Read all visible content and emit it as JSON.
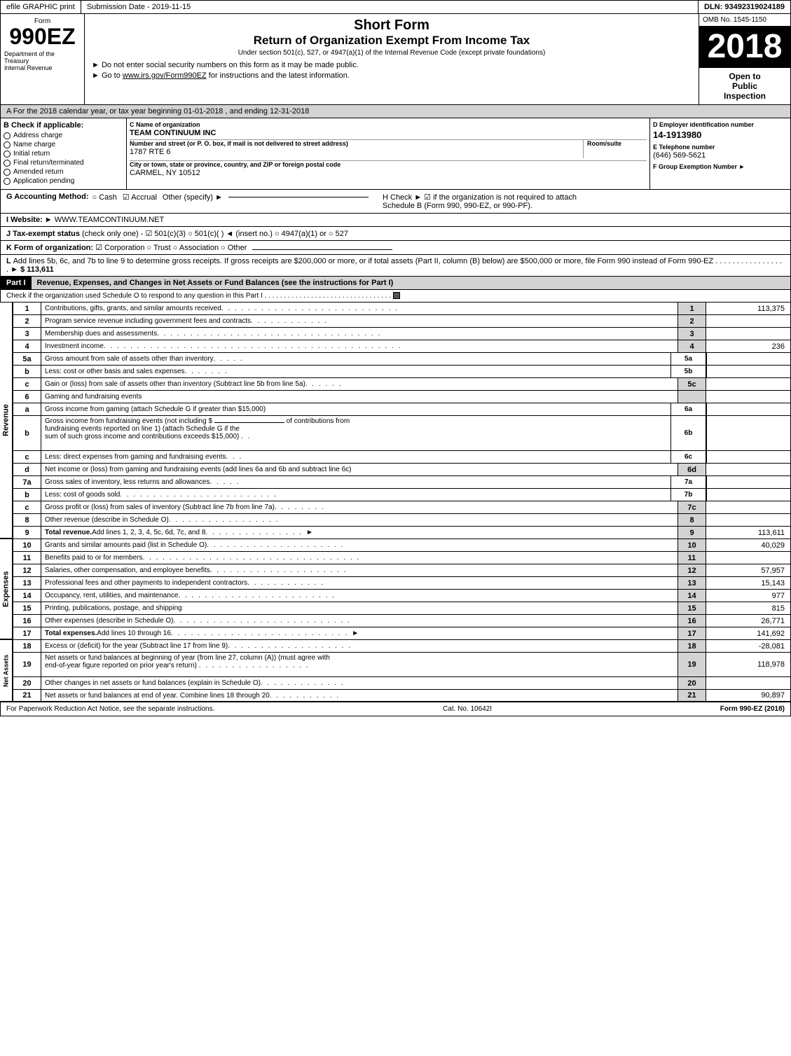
{
  "topbar": {
    "efile": "efile GRAPHIC print",
    "submission_label": "Submission Date - 2019-11-15",
    "dln_label": "DLN: 93492319024189"
  },
  "header": {
    "form_label": "Form",
    "form_number": "990EZ",
    "dept_line1": "Department of the",
    "dept_line2": "Treasury",
    "dept_line3": "Internal Revenue",
    "short_form": "Short Form",
    "return_title": "Return of Organization Exempt From Income Tax",
    "under_section": "Under section 501(c), 527, or 4947(a)(1) of the Internal Revenue Code (except private foundations)",
    "do_not_enter": "► Do not enter social security numbers on this form as it may be made public.",
    "go_to_irs": "► Go to www.irs.gov/Form990EZ for instructions and the latest information.",
    "irs_url": "www.irs.gov/Form990EZ",
    "year": "2018",
    "omb_no": "OMB No. 1545-1150",
    "open_inspection_line1": "Open to",
    "open_inspection_line2": "Public",
    "open_inspection_line3": "Inspection"
  },
  "part_a": {
    "text": "A For the 2018 calendar year, or tax year beginning 01-01-2018      , and ending 12-31-2018"
  },
  "check_b": {
    "label": "B Check if applicable:",
    "items": [
      "Address charge",
      "Name change",
      "Initial return",
      "Final return/terminated",
      "Amended return",
      "Application pending"
    ]
  },
  "org": {
    "c_label": "C Name of organization",
    "name": "TEAM CONTINUUM INC",
    "address_label": "Number and street (or P. O. box, if mail is not delivered to street address)",
    "address": "1787 RTE 6",
    "room_label": "Room/suite",
    "city_label": "City or town, state or province, country, and ZIP or foreign postal code",
    "city": "CARMEL, NY  10512"
  },
  "ein": {
    "d_label": "D Employer identification number",
    "ein_value": "14-1913980",
    "e_label": "E Telephone number",
    "phone": "(646) 569-5621",
    "f_label": "F Group Exemption Number",
    "f_arrow": "►"
  },
  "accounting": {
    "g_label": "G Accounting Method:",
    "cash": "○ Cash",
    "accrual": "☑ Accrual",
    "other": "Other (specify) ►",
    "h_label": "H Check ► ☑ if the organization is not required to attach Schedule B (Form 990, 990-EZ, or 990-PF)."
  },
  "website": {
    "i_label": "I Website: ►",
    "url": "WWW.TEAMCONTINUUM.NET"
  },
  "tax_exempt": {
    "j_label": "J Tax-exempt status",
    "check_only": "(check only one) -",
    "options": "☑ 501(c)(3)  ○ 501(c)(   )  ◄ (insert no.)  ○ 4947(a)(1) or  ○ 527"
  },
  "form_org": {
    "k_label": "K Form of organization:",
    "options": "☑ Corporation  ○ Trust  ○ Association  ○ Other"
  },
  "add_lines": {
    "l_label": "L Add lines 5b, 6c, and 7b to line 9 to determine gross receipts. If gross receipts are $200,000 or more, or if total assets (Part II, column (B) below) are $500,000 or more, file Form 990 instead of Form 990-EZ",
    "dots": "...............",
    "amount": "► $ 113,611"
  },
  "part_i": {
    "label": "Part I",
    "title": "Revenue, Expenses, and Changes in Net Assets or Fund Balances",
    "subtitle": "(see the instructions for Part I)"
  },
  "schedule_o_check": {
    "text": "Check if the organization used Schedule O to respond to any question in this Part I",
    "dots": "........................"
  },
  "revenue_rows": [
    {
      "num": "1",
      "desc": "Contributions, gifts, grants, and similar amounts received",
      "dots": true,
      "line_num": "1",
      "value": "113,375"
    },
    {
      "num": "2",
      "desc": "Program service revenue including government fees and contracts",
      "dots": true,
      "line_num": "2",
      "value": ""
    },
    {
      "num": "3",
      "desc": "Membership dues and assessments",
      "dots": true,
      "line_num": "3",
      "value": ""
    },
    {
      "num": "4",
      "desc": "Investment income",
      "dots": true,
      "line_num": "4",
      "value": "236"
    },
    {
      "num": "5a",
      "desc": "Gross amount from sale of assets other than inventory",
      "dots": false,
      "ref": "5a",
      "line_num": "",
      "value": ""
    },
    {
      "num": "b",
      "desc": "Less: cost or other basis and sales expenses",
      "dots": false,
      "ref": "5b",
      "line_num": "",
      "value": ""
    },
    {
      "num": "c",
      "desc": "Gain or (loss) from sale of assets other than inventory (Subtract line 5b from line 5a)",
      "dots": true,
      "line_num": "5c",
      "value": ""
    },
    {
      "num": "6",
      "desc": "Gaming and fundraising events",
      "dots": false,
      "line_num": "",
      "value": ""
    },
    {
      "num": "a",
      "desc": "Gross income from gaming (attach Schedule G if greater than $15,000)",
      "ref": "6a",
      "dots": false,
      "line_num": "",
      "value": ""
    },
    {
      "num": "b",
      "desc": "Gross income from fundraising events (not including $_____ of contributions from fundraising events reported on line 1) (attach Schedule G if the sum of such gross income and contributions exceeds $15,000)",
      "ref": "6b",
      "dots": false,
      "line_num": "",
      "value": ""
    },
    {
      "num": "c",
      "desc": "Less: direct expenses from gaming and fundraising events",
      "ref": "6c",
      "dots": false,
      "line_num": "",
      "value": ""
    },
    {
      "num": "d",
      "desc": "Net income or (loss) from gaming and fundraising events (add lines 6a and 6b and subtract line 6c)",
      "dots": false,
      "line_num": "6d",
      "value": ""
    },
    {
      "num": "7a",
      "desc": "Gross sales of inventory, less returns and allowances",
      "dots": true,
      "ref": "7a",
      "line_num": "",
      "value": ""
    },
    {
      "num": "b",
      "desc": "Less: cost of goods sold",
      "dots": true,
      "ref": "7b",
      "line_num": "",
      "value": ""
    },
    {
      "num": "c",
      "desc": "Gross profit or (loss) from sales of inventory (Subtract line 7b from line 7a)",
      "dots": true,
      "line_num": "7c",
      "value": ""
    },
    {
      "num": "8",
      "desc": "Other revenue (describe in Schedule O)",
      "dots": true,
      "line_num": "8",
      "value": ""
    },
    {
      "num": "9",
      "desc": "Total revenue. Add lines 1, 2, 3, 4, 5c, 6d, 7c, and 8",
      "dots": true,
      "bold": true,
      "arrow": true,
      "line_num": "9",
      "value": "113,611"
    }
  ],
  "expense_rows": [
    {
      "num": "10",
      "desc": "Grants and similar amounts paid (list in Schedule O)",
      "dots": true,
      "line_num": "10",
      "value": "40,029"
    },
    {
      "num": "11",
      "desc": "Benefits paid to or for members",
      "dots": true,
      "line_num": "11",
      "value": ""
    },
    {
      "num": "12",
      "desc": "Salaries, other compensation, and employee benefits",
      "dots": true,
      "line_num": "12",
      "value": "57,957"
    },
    {
      "num": "13",
      "desc": "Professional fees and other payments to independent contractors",
      "dots": true,
      "line_num": "13",
      "value": "15,143"
    },
    {
      "num": "14",
      "desc": "Occupancy, rent, utilities, and maintenance",
      "dots": true,
      "line_num": "14",
      "value": "977"
    },
    {
      "num": "15",
      "desc": "Printing, publications, postage, and shipping",
      "dots": false,
      "line_num": "15",
      "value": "815"
    },
    {
      "num": "16",
      "desc": "Other expenses (describe in Schedule O)",
      "dots": true,
      "line_num": "16",
      "value": "26,771"
    },
    {
      "num": "17",
      "desc": "Total expenses. Add lines 10 through 16",
      "dots": true,
      "bold": true,
      "arrow": true,
      "line_num": "17",
      "value": "141,692"
    }
  ],
  "net_assets_rows": [
    {
      "num": "18",
      "desc": "Excess or (deficit) for the year (Subtract line 17 from line 9)",
      "dots": true,
      "line_num": "18",
      "value": "-28,081"
    },
    {
      "num": "19",
      "desc": "Net assets or fund balances at beginning of year (from line 27, column (A)) (must agree with end-of-year figure reported on prior year's return)",
      "dots": true,
      "line_num": "19",
      "value": "118,978"
    },
    {
      "num": "20",
      "desc": "Other changes in net assets or fund balances (explain in Schedule O)",
      "dots": true,
      "line_num": "20",
      "value": ""
    },
    {
      "num": "21",
      "desc": "Net assets or fund balances at end of year. Combine lines 18 through 20",
      "dots": true,
      "line_num": "21",
      "value": "90,897"
    }
  ],
  "footer": {
    "paperwork_text": "For Paperwork Reduction Act Notice, see the separate instructions.",
    "cat_no": "Cat. No. 10642I",
    "form_label": "Form 990-EZ (2018)"
  }
}
